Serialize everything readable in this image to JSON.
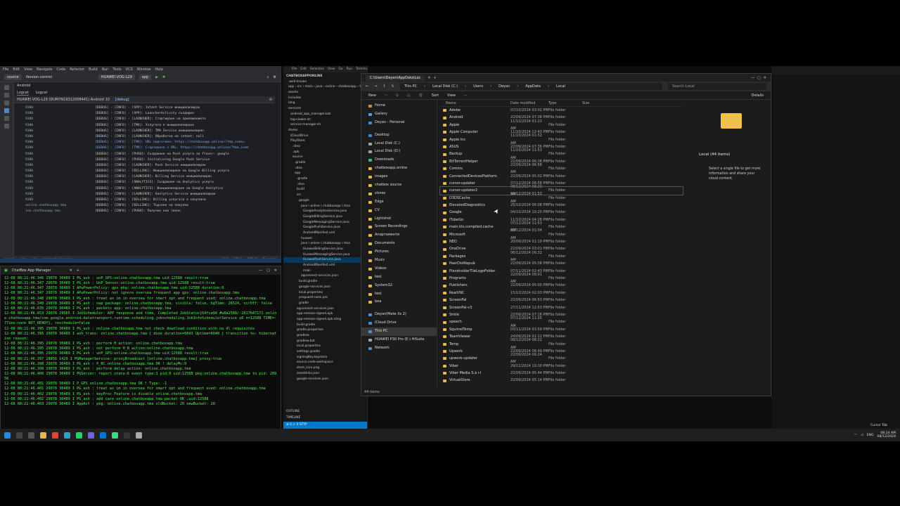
{
  "android_studio": {
    "menu": [
      "File",
      "Edit",
      "View",
      "Navigate",
      "Code",
      "Refactor",
      "Build",
      "Run",
      "Tools",
      "VCS",
      "Window",
      "Help"
    ],
    "project": "source",
    "vcs": "Version control",
    "device": "HUAWEI VOG-L29",
    "run_config": "app",
    "view_mode": "Android",
    "tabs": [
      "Logcat",
      "Logcat"
    ],
    "device_filter": "HUAWEI VOG-L29 (DUM7N19312008441) Android 10",
    "filter_text": "[debug]",
    "log_pids": [
      "9380",
      "9380",
      "9380",
      "9380",
      "9380",
      "9380",
      "9380",
      "9380",
      "9380",
      "9380",
      "9380",
      "9380",
      "9380",
      "9380",
      "9380",
      "9380",
      "9380",
      "online.chatboxapp.tma",
      "ine.chatboxapp.tma"
    ],
    "log_messages": [
      "[DEBUG] - [INFO] - [APP]: Intent Service инициализиран",
      "[DEBUG] - [INFO] - [APP]: LauncherActivity създаден",
      "[DEBUG] - [INFO] - [LAUNCHER]: Стартиране на приложението",
      "[DEBUG] - [INFO] - [TMA]: Услугата е инициализирана",
      "[DEBUG] - [INFO] - [LAUNCHER]: TMA Service инициализиран",
      "[DEBUG] - [INFO] - [LAUNCHER]: Обработка на intent: null",
      "[DEBUG] - [INFO] - [TMA]: URL подготвен: https://chatboxapp.online/?tma_code=",
      "[DEBUG] - [INFO] - [TMA]: Стартиране с URL: https://chatboxapp.online/?tma_code",
      "[DEBUG] - [INFO] - [PUSH]: Създаване на Push услуга за flavor: google",
      "[DEBUG] - [INFO] - [PUSH]: Initializing Google Push Service",
      "[DEBUG] - [INFO] - [LAUNCHER]: Push Service инициализиран",
      "[DEBUG] - [INFO] - [BILLING]: Инициализиране на Google Billing услуга",
      "[DEBUG] - [INFO] - [LAUNCHER]: Billing Service инициализиран",
      "[DEBUG] - [INFO] - [ANALYTICS]: Създаване на Analytics услуга",
      "[DEBUG] - [INFO] - [ANALYTICS]: Инициализиране на Google Analytics",
      "[DEBUG] - [INFO] - [LAUNCHER]: Analytics Service инициализиран",
      "[DEBUG] - [INFO] - [BILLING]: Billing услугата е свързана",
      "[DEBUG] - [INFO] - [BILLING]: Търсене на покупки",
      "[DEBUG] - [INFO] - [PUSH]: Получен нов токен"
    ],
    "statusbar": [
      "source",
      "app",
      "src",
      "proguard-rules.pro",
      "1:1",
      "CRLF",
      "UTF-8",
      "4 spaces"
    ]
  },
  "terminal": {
    "title": "ChatBox App Manager",
    "lines": [
      "12-08 08:21:46.346 29078 30489 I PG_ash : unP_GPS:online.chatboxapp.tma uid:12588 result:true",
      "12-08 08:21:46.347 29078 30489 I PG_ash : UnP_Sensor:online.chatboxapp.tma uid:12588 result:true",
      "12-08 08:21:46.347 29078 30489 I APwPowerPolicy: gps pkg: online.chatboxapp.tma uid:12588 duration:0",
      "12-08 08:21:46.347 29078 30489 I APwPowerPolicy: not ignore oversea frequent app gps: online.chatboxapp.tma",
      "12-08 08:21:46.348 29078 30489 I PG_ash : treat as im in oversea for smart opt and frequent used: online.chatboxapp.tma",
      "12-08 08:21:46.348 29078 30489 I PG_ash : nap package: online.chatboxapp.tma, visible: false, bgTime: 26524, scrOff: false",
      "12-08 08:21:46.635 29078 30489 I PG_ash : packets app: online.chatboxapp.tma",
      "12-08 08:21:46.653 29078 29565 I JobScheduler: APP response and time, Completed JobStatus{64fca94 #u0a2588/-2017647171 online.chatboxapp.tma/com.google.android.datatransport.runtime.scheduling.jobscheduling.JobInfoSchedulerService u0 n=12588 TIME=-77ims:none NOT_READY}, reschedule=false",
      "12-08 08:21:46.395 29078 30489 I PG_ash : online.chatboxapp.tma not check download condition with no dl requisites",
      "12-08 08:21:46.395 29078 30489 I ash_trans: online.chatboxapp.tma { doze duration=6043 Uptime=6040 } transition to: hibernation reason:",
      "12-08 08:21:46.395 29078 30489 I PG_ash : perform H action: online.chatboxapp.tma",
      "12-08 08:21:46.395 29078 30489 I PG_ash : not perform H_B action:online.chatboxapp.tma",
      "12-08 08:21:46.395 29078 30489 I PG_ash : unP_GPS:online.chatboxapp.tma uid:12588 result:true",
      "12-08 08:21:46.397 28856 1420 I PGManagerService: proxyBroadcast [online.chatboxapp.tma] proxy:true",
      "12-08 08:21:46.398 29078 30489 I PG_ash : P_BC online.chatboxapp.tma OK ! delayMs:0",
      "12-08 08:21:46.398 29078 30489 I PG_ash : perform delay action: online.chatboxapp.tma",
      "12-08 08:21:46.400 29078 30489 I PGServer: report state:6 event type:1 pid:0 uid:12588 pkg:online.chatboxapp.tma to pid: 28956",
      "12-08 08:21:46.401 29078 30489 I P_GPS online.chatboxapp.tma OK ! Type: -1",
      "12-08 08:21:46.401 29078 30489 I PG_ash : treat as im in oversea for smart opt and frequent used: online.chatboxapp.tma",
      "12-08 08:21:46.402 29078 30489 I PG_ash : keyProc Feature is disable online.chatboxapp.tma",
      "12-08 08:21:46.402 29078 30489 I PG_ash : add care online.chatboxapp.tma packet OK ,uid:12588",
      "12-08 08:21:46.403 29078 30489 I AppAct : pkg: online.chatboxapp.tma oldBucket: 20 newBucket: 20"
    ]
  },
  "vscode": {
    "menu": [
      "File",
      "Edit",
      "Selection",
      "View",
      "Go",
      "Run",
      "Terminal",
      "Help"
    ],
    "tree": [
      "CHATBOXAPPONLINE",
      ".well-known",
      "app › src › main › java › online › chatboxapp › tma",
      "assets",
      "includes",
      "lang",
      "services",
      "android_app_manager.bat",
      "log-viewer.sh",
      "service-manager.sh",
      "stores",
      "iCloudDrive",
      "PlayStore",
      ".idea",
      ".apk",
      "source",
      ".gradle",
      ".idea",
      "app",
      ".gradle",
      ".idea",
      "build",
      "src",
      "google",
      "java \\ online \\ chatboxapp \\ tma",
      "GoogleAnalyticsService.java",
      "GoogleBillingService.java",
      "GoogleMessagingService.java",
      "GooglePushService.java",
      "AndroidManifest.xml",
      "huawei",
      "java \\ online \\ chatboxapp \\ tma",
      "HuaweiBillingService.java",
      "HuaweiMessagingService.java",
      "HuaweiPushService.java",
      "AndroidManifest.xml",
      "main",
      "agconnect-services.json",
      "build.gradle",
      "google-services.json",
      "local.properties",
      "proguard-rules.pro",
      "gradle",
      "agconnect-services.json",
      "app-release-signed.apk",
      "app-release-signed.apk.idsig",
      "build.gradle",
      "gradle.properties",
      "gradlew",
      "gradlew.bat",
      "local.properties",
      "settings.gradle",
      "signingKey.keystore",
      "source.code-workspace",
      "store_icon.png",
      "assetlinks.json",
      "google-services.json"
    ],
    "selected_index": 34,
    "outline": "OUTLINE",
    "timeline": "TIMELINE",
    "status": "⊗ 0 ⚠ 0  SFTP"
  },
  "explorer": {
    "tab": "C:\\Users\\Deyan\\AppData\\Loc",
    "breadcrumb": [
      "This PC",
      "Local Disk (C:)",
      "Users",
      "Deyan",
      "AppData",
      "Local"
    ],
    "search_placeholder": "Search Local",
    "commands": [
      "New",
      "Sort",
      "View",
      "···",
      "Details"
    ],
    "nav": [
      {
        "label": "Home",
        "type": "home"
      },
      {
        "label": "Gallery",
        "type": "gallery"
      },
      {
        "label": "Deyan - Personal",
        "type": "cloud"
      },
      {
        "label": "",
        "type": "gap"
      },
      {
        "label": "Desktop",
        "type": "desk"
      },
      {
        "label": "Local Disk (C:)",
        "type": "drive"
      },
      {
        "label": "Local Disk (D:)",
        "type": "drive"
      },
      {
        "label": "Downloads",
        "type": "down"
      },
      {
        "label": "chatboxapp.online",
        "type": "folder"
      },
      {
        "label": "images",
        "type": "folder"
      },
      {
        "label": "chatbox source",
        "type": "folder"
      },
      {
        "label": "stores",
        "type": "folder"
      },
      {
        "label": "Edge",
        "type": "folder"
      },
      {
        "label": "CV",
        "type": "folder"
      },
      {
        "label": "Lightshot",
        "type": "folder"
      },
      {
        "label": "Screen Recordings",
        "type": "folder"
      },
      {
        "label": "Апартаменти",
        "type": "folder"
      },
      {
        "label": "Documents",
        "type": "folder"
      },
      {
        "label": "Pictures",
        "type": "folder"
      },
      {
        "label": "Music",
        "type": "folder"
      },
      {
        "label": "Videos",
        "type": "folder"
      },
      {
        "label": "test",
        "type": "folder"
      },
      {
        "label": "System32",
        "type": "folder"
      },
      {
        "label": "test",
        "type": "folder"
      },
      {
        "label": "bea",
        "type": "folder"
      },
      {
        "label": "",
        "type": "gap"
      },
      {
        "label": "Deyan(Mate Xs 2)",
        "type": "pc"
      },
      {
        "label": "iCloud Drive",
        "type": "cloud"
      },
      {
        "label": "This PC",
        "type": "pc",
        "sel": true
      },
      {
        "label": "HUAWEI P30 Pro (E:) HiSuite",
        "type": "drive"
      },
      {
        "label": "Network",
        "type": "net"
      }
    ],
    "columns": [
      "Name",
      "Date modified",
      "Type",
      "Size"
    ],
    "files": [
      [
        "Adobe",
        "07/10/2024 03:02 PM",
        "File folder"
      ],
      [
        "Android",
        "22/09/2024 07:38 PM",
        "File folder"
      ],
      [
        "Apple",
        "11/10/2024 01:23 AM",
        "File folder"
      ],
      [
        "Apple Computer",
        "11/10/2024 12:43 PM",
        "File folder"
      ],
      [
        "Apple Inc",
        "11/10/2024 01:52 AM",
        "File folder"
      ],
      [
        "ASUS",
        "22/09/2024 07:36 PM",
        "File folder"
      ],
      [
        "Backup",
        "11/10/2024 11:53 AM",
        "File folder"
      ],
      [
        "BitTorrentHelper",
        "22/09/2024 06:38 PM",
        "File folder"
      ],
      [
        "Comms",
        "22/09/2024 06:58 AM",
        "File folder"
      ],
      [
        "ConnectedDevicesPlatform",
        "22/09/2024 05:02 PM",
        "File folder"
      ],
      [
        "cursor-updater",
        "07/12/2024 08:58 PM",
        "File folder"
      ],
      [
        "cursor-updater2",
        "08/12/2024 08:23 AM",
        "File folder"
      ],
      [
        "D3DSCache",
        "08/12/2024 01:53 AM",
        "File folder"
      ],
      [
        "ElevatedDiagnostics",
        "25/10/2024 06:08 PM",
        "File folder"
      ],
      [
        "Google",
        "04/10/2024 10:20 PM",
        "File folder"
      ],
      [
        "iTubeGo",
        "11/10/2024 04:28 PM",
        "File folder"
      ],
      [
        "main.kts.compiled.cache",
        "07/12/2024 11:53 AM",
        "File folder"
      ],
      [
        "Microsoft",
        "05/12/2024 01:04 AM",
        "File folder"
      ],
      [
        "NEO",
        "20/09/2024 01:19 PM",
        "File folder"
      ],
      [
        "OneDrive",
        "22/09/2024 03:01 PM",
        "File folder"
      ],
      [
        "Packages",
        "06/12/2024 06:32 AM",
        "File folder"
      ],
      [
        "PeerDistRepub",
        "22/09/2024 05:08 PM",
        "File folder"
      ],
      [
        "PlaceholderTileLogoFolder",
        "07/11/2024 02:43 PM",
        "File folder"
      ],
      [
        "Programs",
        "22/09/2024 06:01 AM",
        "File folder"
      ],
      [
        "Publishers",
        "22/09/2024 05:00 PM",
        "File folder"
      ],
      [
        "RealVNC",
        "15/10/2024 02:03 PM",
        "File folder"
      ],
      [
        "ScreenPal",
        "22/09/2024 06:53 PM",
        "File folder"
      ],
      [
        "ScreenPal-v3",
        "27/11/2024 12:53 PM",
        "File folder"
      ],
      [
        "Smile",
        "22/09/2024 07:16 PM",
        "File folder"
      ],
      [
        "speech",
        "07/12/2024 11:25 AM",
        "File folder"
      ],
      [
        "SquirrelTemp",
        "03/11/2024 03:59 PM",
        "File folder"
      ],
      [
        "TeamViewer",
        "24/09/2024 01:11 PM",
        "File folder"
      ],
      [
        "Temp",
        "08/12/2024 08:22 AM",
        "File folder"
      ],
      [
        "Upwork",
        "22/09/2024 06:49 PM",
        "File folder"
      ],
      [
        "upwork-updater",
        "22/09/2024 06:24 AM",
        "File folder"
      ],
      [
        "Viber",
        "29/11/2024 10:30 PM",
        "File folder"
      ],
      [
        "Viber Media S.à r.l",
        "22/09/2024 05:44 PM",
        "File folder"
      ],
      [
        "VirtualStore",
        "22/09/2024 05:14 PM",
        "File folder"
      ]
    ],
    "highlighted_index": 11,
    "details_title": "Local (44 items)",
    "details_hint": "Select a single file to get more information and share your cloud content.",
    "status": "44 items"
  },
  "taskbar": {
    "lang": "ENG",
    "time": "08:24 AM",
    "date": "08/12/2024",
    "tooltip": "Cursor Tab"
  }
}
